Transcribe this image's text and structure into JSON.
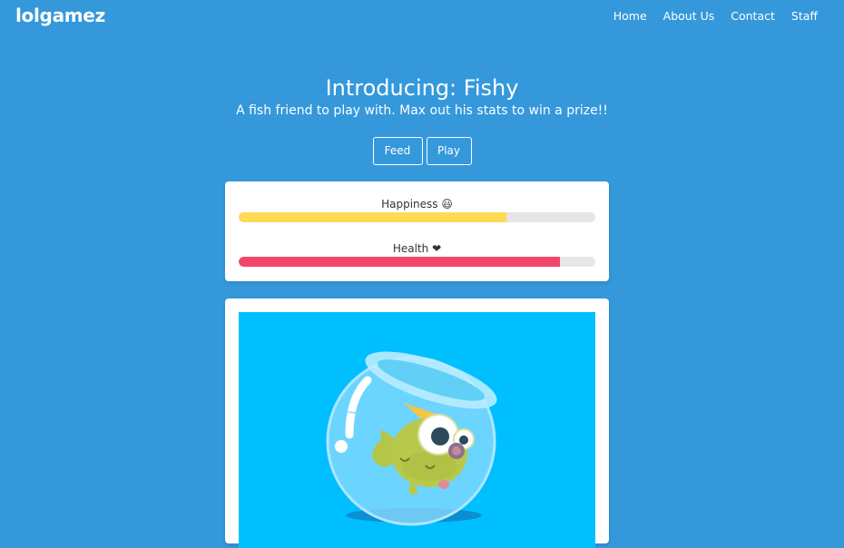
{
  "nav": {
    "brand": "lolgamez",
    "links": [
      "Home",
      "About Us",
      "Contact",
      "Staff"
    ]
  },
  "hero": {
    "title": "Introducing: Fishy",
    "subtitle": "A fish friend to play with. Max out his stats to win a prize!!"
  },
  "actions": {
    "feed_label": "Feed",
    "play_label": "Play"
  },
  "stats": {
    "happiness": {
      "label": "Happiness 😃",
      "value": 0.75,
      "color": "#ffda55"
    },
    "health": {
      "label": "Health ❤",
      "value": 0.9,
      "color": "#f0476a"
    }
  },
  "colors": {
    "page_bg": "#3498db",
    "scene_bg": "#00bfff"
  }
}
